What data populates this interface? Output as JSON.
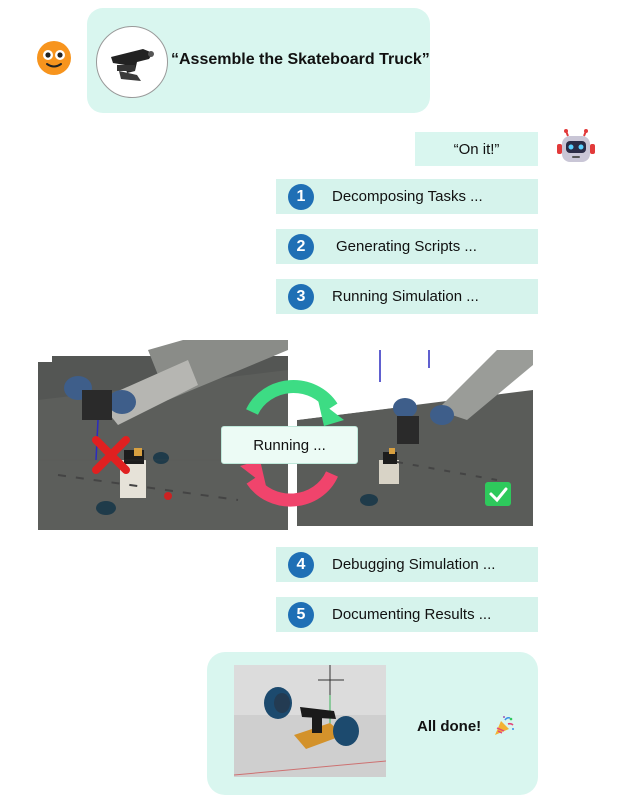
{
  "user": {
    "avatar_icon": "smiley-face-icon",
    "request_text": "“Assemble the Skateboard Truck”",
    "thumbnail_icon": "skateboard-truck-part-image"
  },
  "agent": {
    "avatar_icon": "robot-head-icon",
    "reply_text": "“On it!”"
  },
  "steps": [
    {
      "number": "1",
      "label": "Decomposing Tasks ..."
    },
    {
      "number": "2",
      "label": "Generating Scripts ..."
    },
    {
      "number": "3",
      "label": "Running Simulation ..."
    },
    {
      "number": "4",
      "label": "Debugging Simulation ..."
    },
    {
      "number": "5",
      "label": "Documenting Results ..."
    }
  ],
  "simulation": {
    "running_label": "Running ...",
    "fail_icon": "red-x-icon",
    "success_icon": "green-check-icon",
    "cycle_icon": "refresh-cycle-icon"
  },
  "final": {
    "done_text": "All done!",
    "celebrate_icon": "party-popper-icon",
    "result_image": "assembled-skateboard-truck-render"
  },
  "colors": {
    "bubble": "#d9f6ef",
    "step_bg": "#d6f3ec",
    "step_number": "#1f6fb5",
    "arrow_green": "#3ddc84",
    "arrow_pink": "#f0446c",
    "fail_red": "#e02020",
    "success_green": "#2ec95c",
    "user_avatar": "#f7941d"
  }
}
